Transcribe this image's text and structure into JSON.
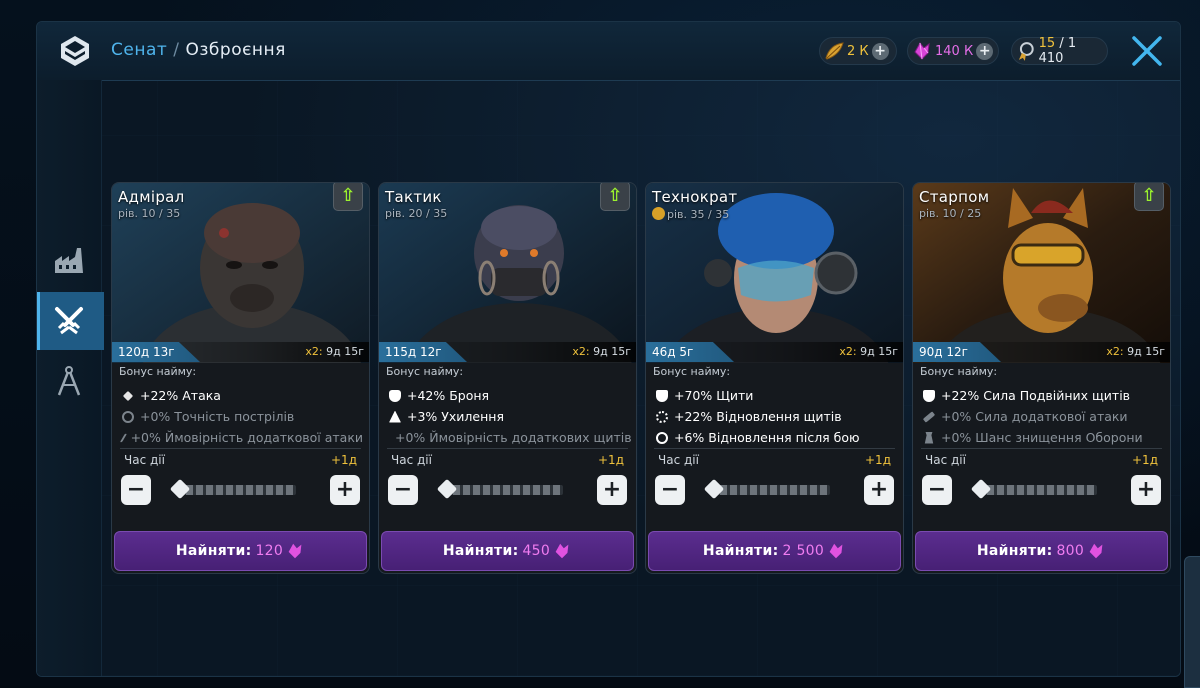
{
  "header": {
    "breadcrumb_parent": "Сенат",
    "breadcrumb_sep": "/",
    "title": "Озброєння"
  },
  "resources": {
    "gold": "2 К",
    "crystals": "140 К",
    "medals_current": "15",
    "medals_sep": " / ",
    "medals_total": "1 410"
  },
  "sidebar": {
    "items": [
      {
        "icon": "factory-icon",
        "active": false
      },
      {
        "icon": "crossed-swords-icon",
        "active": true
      },
      {
        "icon": "compass-icon",
        "active": false
      }
    ]
  },
  "labels": {
    "bonus_title": "Бонус найму:",
    "duration": "Час дії",
    "hire": "Найняти:"
  },
  "cards": [
    {
      "name": "Адмірал",
      "level": "рів. 10 / 35",
      "timer": "120д 13г",
      "x2": "x2:",
      "x2_time": "9д 15г",
      "bonuses": [
        {
          "text": "+22% Атака",
          "active": true
        },
        {
          "text": "+0% Точність пострілів",
          "active": false
        },
        {
          "text": "+0% Ймовірність додаткової атаки",
          "active": false
        }
      ],
      "duration_add": "+1д",
      "price": "120"
    },
    {
      "name": "Тактик",
      "level": "рів. 20 / 35",
      "timer": "115д 12г",
      "x2": "x2:",
      "x2_time": "9д 15г",
      "bonuses": [
        {
          "text": "+42% Броня",
          "active": true
        },
        {
          "text": "+3% Ухилення",
          "active": true
        },
        {
          "text": "+0% Ймовірність додаткових щитів",
          "active": false
        }
      ],
      "duration_add": "+1д",
      "price": "450"
    },
    {
      "name": "Технократ",
      "level": "рів. 35 / 35",
      "timer": "46д 5г",
      "x2": "x2:",
      "x2_time": "9д 15г",
      "bonuses": [
        {
          "text": "+70% Щити",
          "active": true
        },
        {
          "text": "+22% Відновлення щитів",
          "active": true
        },
        {
          "text": "+6% Відновлення після бою",
          "active": true
        }
      ],
      "duration_add": "+1д",
      "price": "2 500"
    },
    {
      "name": "Старпом",
      "level": "рів. 10 / 25",
      "timer": "90д 12г",
      "x2": "x2:",
      "x2_time": "9д 15г",
      "bonuses": [
        {
          "text": "+22% Сила Подвійних щитів",
          "active": true
        },
        {
          "text": "+0% Сила додаткової атаки",
          "active": false
        },
        {
          "text": "+0% Шанс знищення Оборони",
          "active": false
        }
      ],
      "duration_add": "+1д",
      "price": "800"
    }
  ],
  "colors": {
    "accent": "#4fb4ec",
    "gold": "#f0c23c",
    "crystal": "#e46ee8",
    "hire_button": "#5b2d8f",
    "upgrade_arrow": "#9cf22e"
  }
}
